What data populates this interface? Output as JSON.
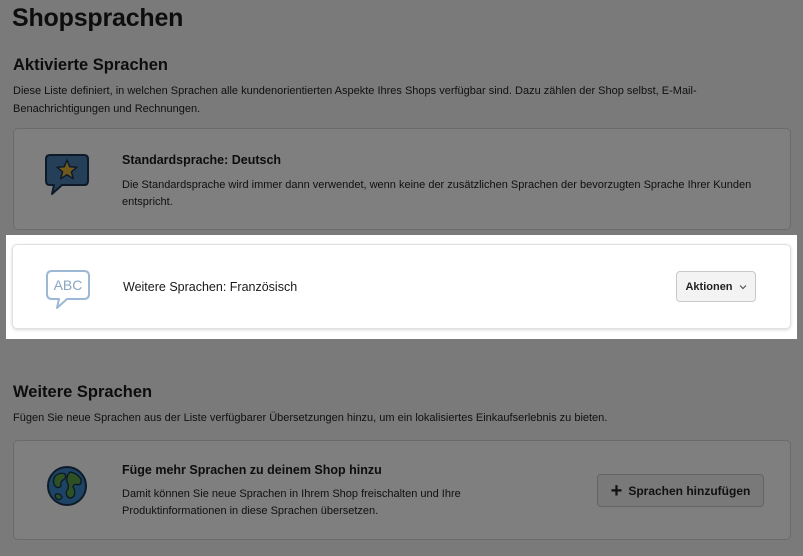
{
  "page": {
    "title": "Shopsprachen"
  },
  "active": {
    "heading": "Aktivierte Sprachen",
    "description": "Diese Liste definiert, in welchen Sprachen alle kundenorientierten Aspekte Ihres Shops verfügbar sind. Dazu zählen der Shop selbst, E-Mail-Benachrichtigungen und Rechnungen.",
    "default_card": {
      "title": "Standardsprache: Deutsch",
      "text": "Die Standardsprache wird immer dann verwendet, wenn keine der zusätzlichen Sprachen der bevorzugten Sprache Ihrer Kunden entspricht.",
      "icon": "star-speech-bubble-icon"
    },
    "additional_card": {
      "title": "Weitere Sprachen: Französisch",
      "icon_text": "ABC",
      "icon": "abc-speech-bubble-icon",
      "actions_label": "Aktionen"
    }
  },
  "more": {
    "heading": "Weitere Sprachen",
    "description": "Fügen Sie neue Sprachen aus der Liste verfügbarer Übersetzungen hinzu, um ein lokalisiertes Einkaufserlebnis zu bieten.",
    "card": {
      "title": "Füge mehr Sprachen zu deinem Shop hinzu",
      "text": "Damit können Sie neue Sprachen in Ihrem Shop freischalten und Ihre Produktinformationen in diese Sprachen übersetzen.",
      "icon": "globe-icon",
      "button_label": "Sprachen hinzufügen"
    }
  },
  "colors": {
    "overlay": "#000000",
    "bubble_blue": "#4a7fb0",
    "star_gold": "#e2b33c",
    "abc_bubble": "#9cb8d4",
    "globe_ocean": "#3a88c9",
    "globe_land": "#5aa34a"
  }
}
